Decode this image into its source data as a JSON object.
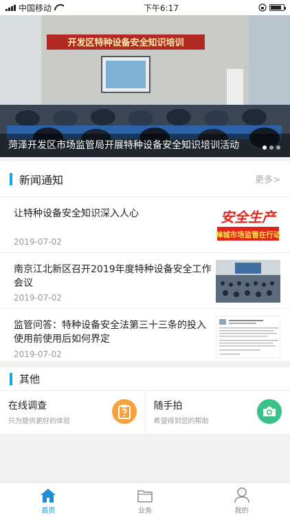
{
  "status_bar": {
    "carrier": "中国移动",
    "time": "下午6:17"
  },
  "banner": {
    "sign_text": "开发区特种设备安全知识培训",
    "caption": "菏泽开发区市场监管局开展特种设备安全知识培训活动",
    "slide_count": 3,
    "active_slide": 1
  },
  "news": {
    "title": "新闻通知",
    "more": "更多>",
    "items": [
      {
        "title": "让特种设备安全知识深入人心",
        "date": "2019-07-02",
        "thumb_line1": "安全生产",
        "thumb_line2": "禅城市场监管在行动"
      },
      {
        "title": "南京江北新区召开2019年度特种设备安全工作会议",
        "date": "2019-07-02"
      },
      {
        "title": "监管问答：特种设备安全法第三十三条的投入使用前使用后如何界定",
        "date": "2019-07-02"
      }
    ]
  },
  "others": {
    "title": "其他",
    "items": [
      {
        "title": "在线调查",
        "subtitle": "只为提供更好的体验",
        "icon": "survey-icon",
        "color": "#f5a23a"
      },
      {
        "title": "随手拍",
        "subtitle": "希望得到您的帮助",
        "icon": "camera-icon",
        "color": "#3cc08a"
      }
    ]
  },
  "tabbar": {
    "items": [
      {
        "label": "首页",
        "icon": "home-icon",
        "active": true
      },
      {
        "label": "业务",
        "icon": "folder-icon",
        "active": false
      },
      {
        "label": "我的",
        "icon": "user-icon",
        "active": false
      }
    ]
  },
  "colors": {
    "accent": "#1e8fd6",
    "section_bar": "#1aa3e8"
  }
}
